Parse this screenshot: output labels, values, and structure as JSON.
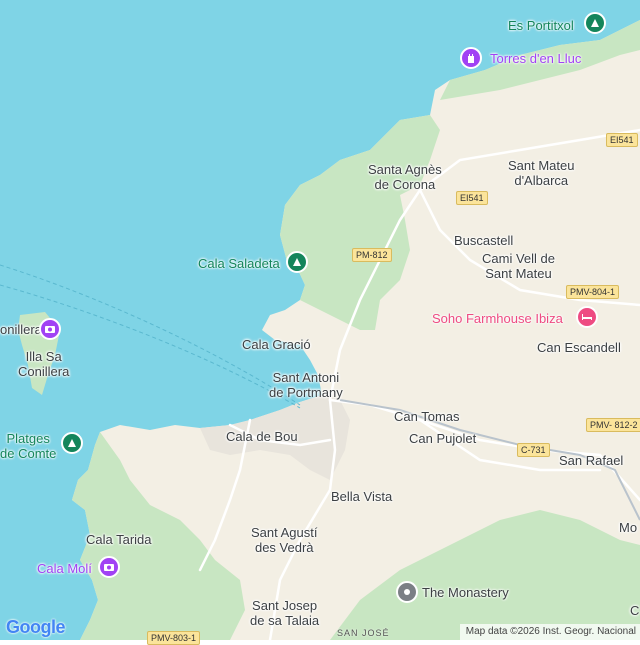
{
  "map": {
    "colors": {
      "water": "#7fd4e6",
      "land": "#f3efe4",
      "forest": "#c8e6c2",
      "road": "#ffffff",
      "highway": "#fbe49a",
      "town": "#ece9e3",
      "recreation_marker": "#14855b",
      "landmark_marker": "#a142f4",
      "lodging_marker": "#ee4b82",
      "generic_marker": "#7b7f85"
    },
    "places": {
      "santa_agnes": [
        "Santa Agnès",
        "de Corona"
      ],
      "sant_mateu": [
        "Sant Mateu",
        "d'Albarca"
      ],
      "buscastell": "Buscastell",
      "cami_vell": [
        "Cami Vell de",
        "Sant Mateu"
      ],
      "can_escandell": "Can Escandell",
      "cala_gracio": "Cala Gració",
      "sant_antoni": [
        "Sant Antoni",
        "de Portmany"
      ],
      "can_tomas": "Can Tomas",
      "can_pujolet": "Can Pujolet",
      "san_rafael": "San Rafael",
      "cala_de_bou": "Cala de Bou",
      "bella_vista": "Bella Vista",
      "cala_tarida": "Cala Tarida",
      "sant_agusti": [
        "Sant Agustí",
        "des Vedrà"
      ],
      "sant_josep": [
        "Sant Josep",
        "de sa Talaia"
      ],
      "illa_conillera": [
        "Illa Sa",
        "Conillera"
      ],
      "conillera_edge": "onillera",
      "mo_edge": "Mo",
      "c_edge": "C",
      "san_jose": "SAN JOSÉ"
    },
    "pois": {
      "es_portitxol": "Es Portitxol",
      "torres_lluc": "Torres d'en Lluc",
      "cala_saladeta": "Cala Saladeta",
      "soho_farmhouse": "Soho Farmhouse Ibiza",
      "platges_comte": [
        "Platges",
        "de Comte"
      ],
      "cala_moli": "Cala Molí",
      "the_monastery": "The Monastery"
    },
    "roads": {
      "ei541_a": "EI541",
      "ei541_b": "EI541",
      "pm812": "PM-812",
      "pmv8041": "PMV-804-1",
      "pmv8122": "PMV- 812-2",
      "c731": "C-731",
      "pmv8031": "PMV-803-1"
    }
  },
  "footer": {
    "logo": "Google",
    "attribution": "Map data ©2026 Inst. Geogr. Nacional"
  }
}
